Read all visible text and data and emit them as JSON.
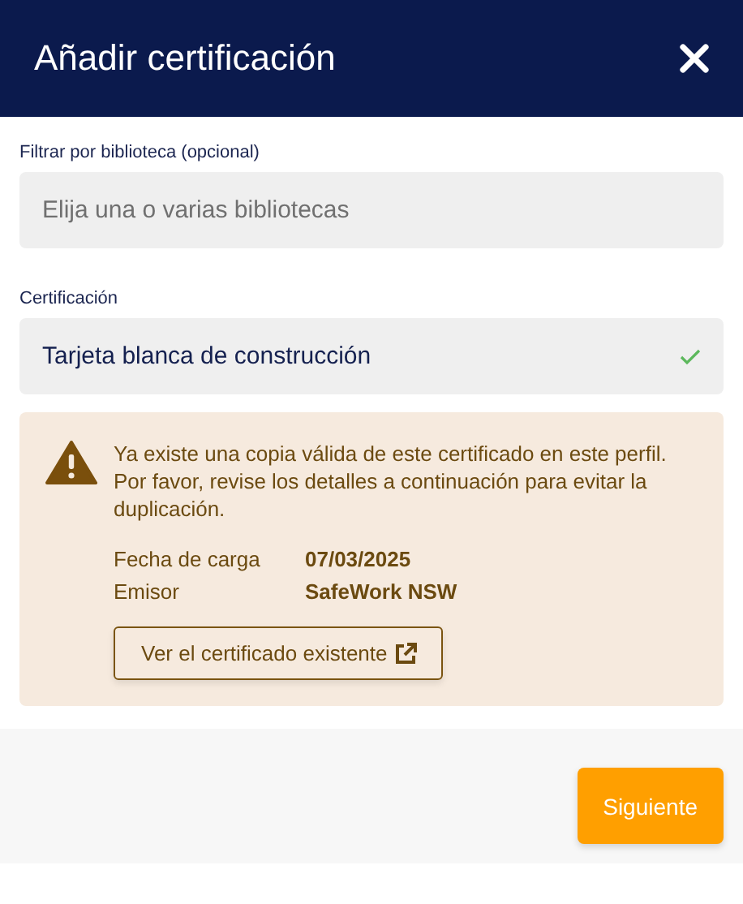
{
  "window": {
    "title": "Añadir certificación"
  },
  "fields": [
    {
      "label": "Filtrar por biblioteca (opcional)",
      "placeholder": "Elija una o varias bibliotecas"
    },
    {
      "label": "Certificación",
      "value": "Tarjeta blanca de construcción",
      "valid": true
    }
  ],
  "warning": {
    "message": "Ya existe una copia válida de este certificado en este perfil. Por favor, revise los detalles a continuación para evitar la duplicación.",
    "details": [
      {
        "label": "Fecha de carga",
        "value": "07/03/2025"
      },
      {
        "label": "Emisor",
        "value": "SafeWork NSW"
      }
    ],
    "button": "Ver el certificado existente"
  },
  "footer": {
    "button": "Siguiente"
  }
}
